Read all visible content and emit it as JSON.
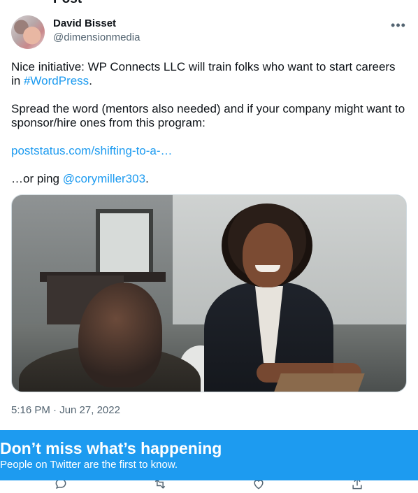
{
  "header": {
    "partial_title": "Post"
  },
  "author": {
    "display_name": "David Bisset",
    "handle": "@dimensionmedia",
    "avatar_icon": "user-avatar-photo"
  },
  "tweet": {
    "p1_pre": "Nice initiative: WP Connects LLC will train folks who want to start careers in ",
    "p1_hashtag": "#WordPress",
    "p1_post": ".",
    "p2": "Spread the word (mentors also needed) and if your company might want to sponsor/hire ones from this program:",
    "p3_link": "poststatus.com/shifting-to-a-…",
    "p4_pre": "…or ping ",
    "p4_mention": "@corymiller303",
    "p4_post": ".",
    "timestamp": "5:16 PM · Jun 27, 2022"
  },
  "media": {
    "kind": "photo"
  },
  "actions": {
    "icons": [
      "reply-icon",
      "retweet-icon",
      "like-icon",
      "share-icon"
    ]
  },
  "banner": {
    "title": "Don’t miss what’s happening",
    "subtitle": "People on Twitter are the first to know."
  },
  "colors": {
    "accent": "#1d9bf0",
    "text_primary": "#0f1419",
    "text_secondary": "#536471",
    "border": "#cfd9de"
  }
}
